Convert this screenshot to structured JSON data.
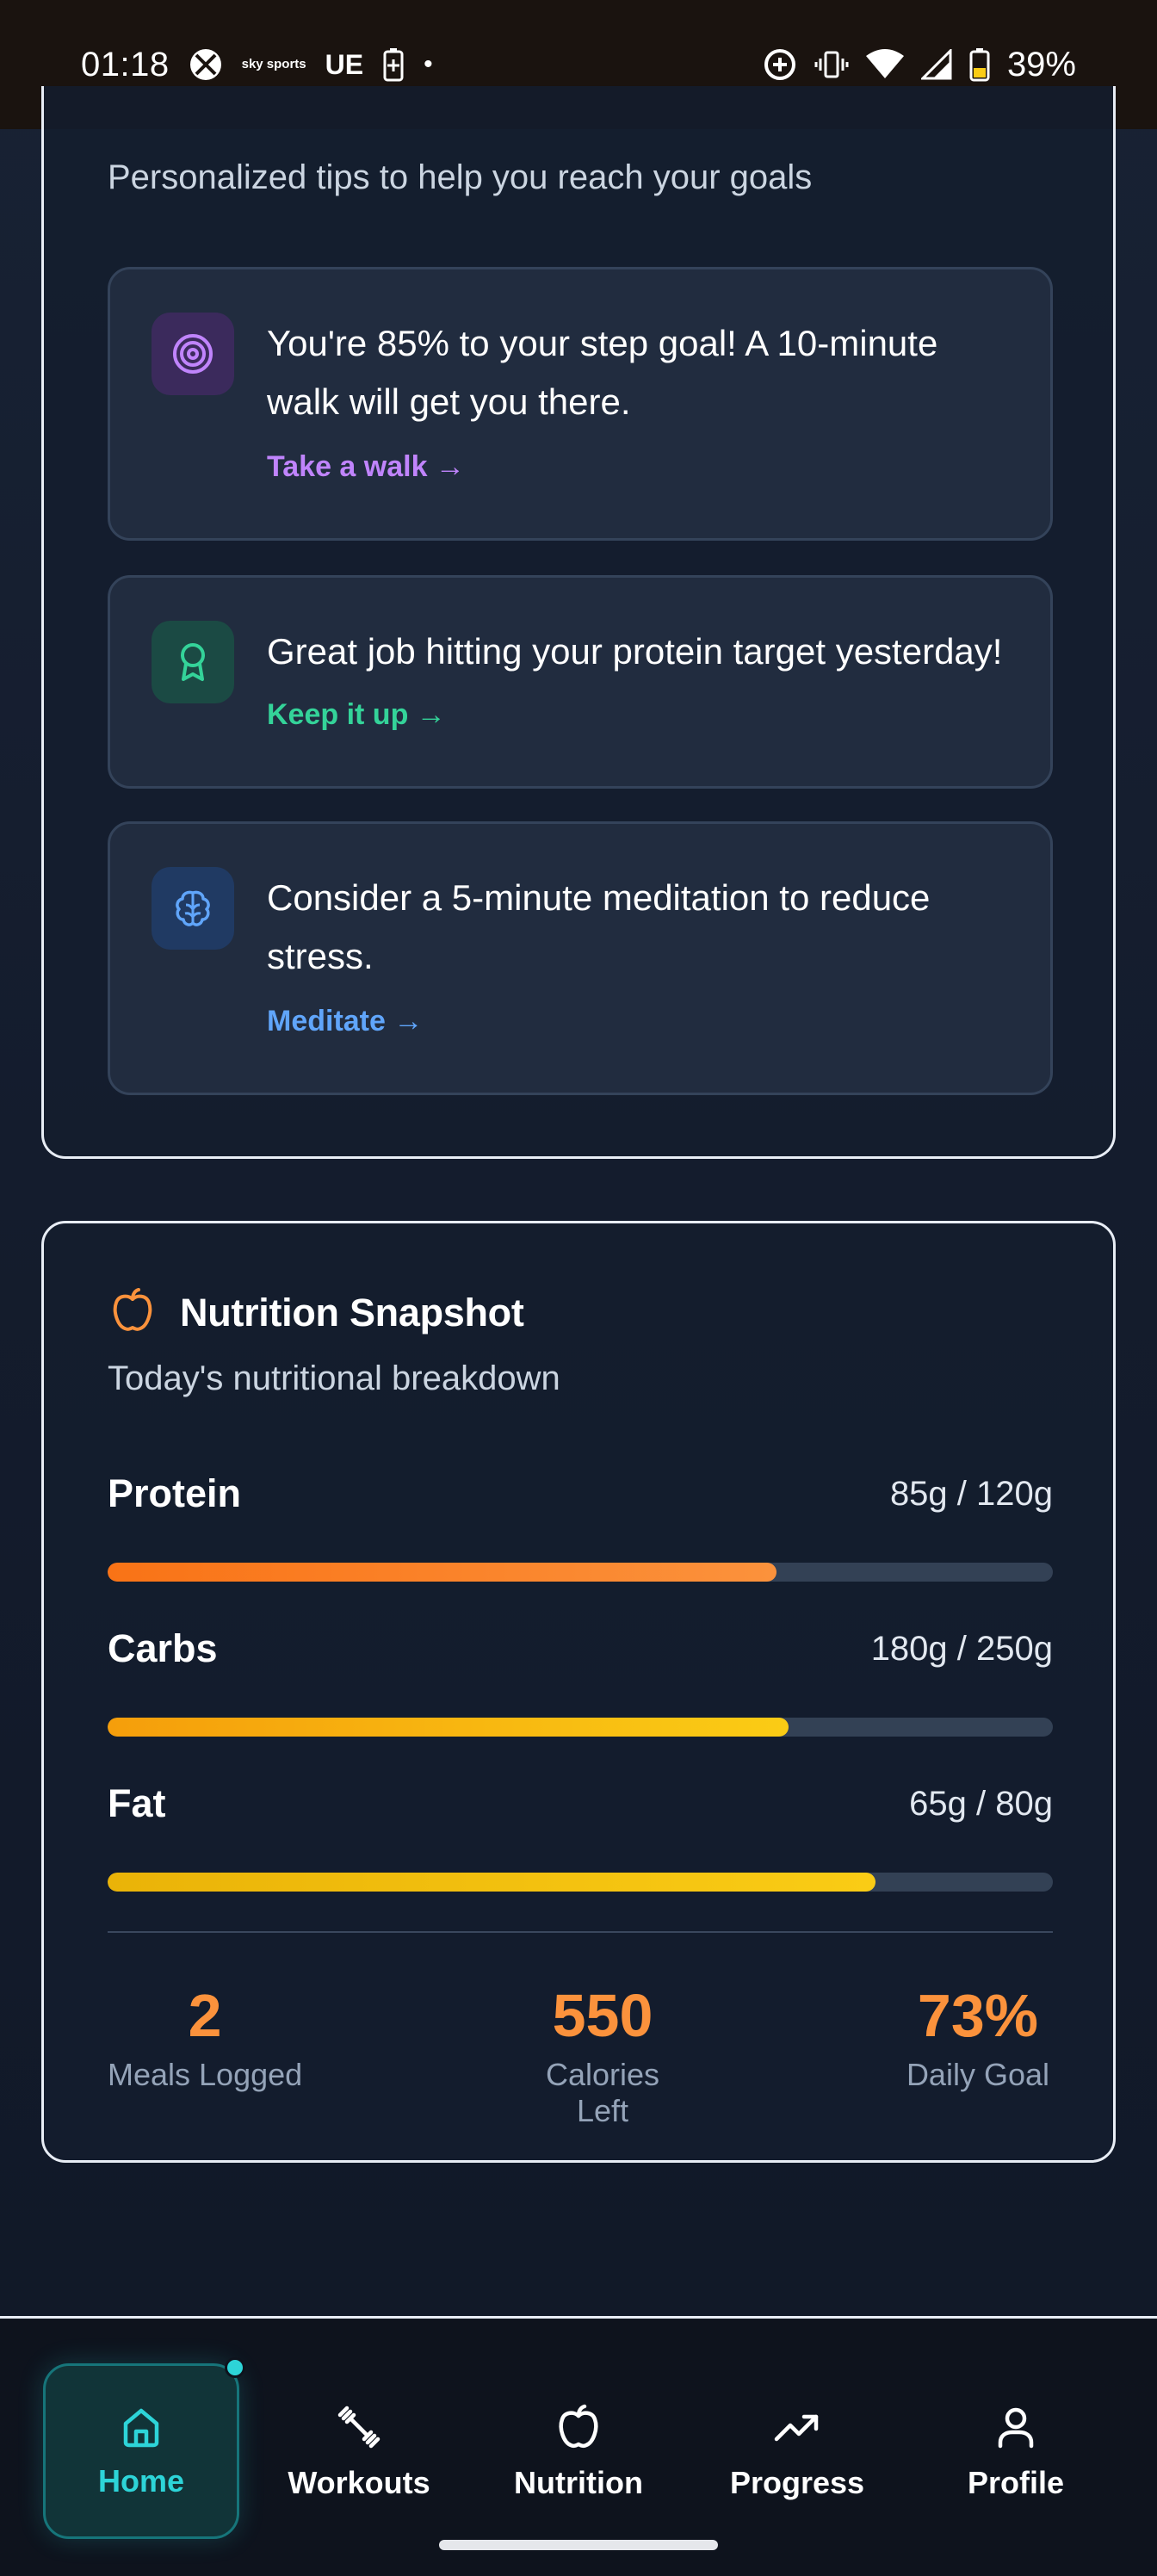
{
  "status_bar": {
    "time": "01:18",
    "sky_sports": "sky sports",
    "ue": "UE",
    "battery": "39%"
  },
  "insights": {
    "subtitle": "Personalized tips to help you reach your goals",
    "tips": [
      {
        "text": "You're 85% to your step goal! A 10-minute walk will get you there.",
        "action": "Take a walk →",
        "icon": "target-icon",
        "color": "#c084fc"
      },
      {
        "text": "Great job hitting your protein target yesterday!",
        "action": "Keep it up →",
        "icon": "award-icon",
        "color": "#34d399"
      },
      {
        "text": "Consider a 5-minute meditation to reduce stress.",
        "action": "Meditate →",
        "icon": "brain-icon",
        "color": "#60a5fa"
      }
    ]
  },
  "nutrition": {
    "title": "Nutrition Snapshot",
    "subtitle": "Today's nutritional breakdown",
    "macros": [
      {
        "name": "Protein",
        "amount": "85g / 120g",
        "progress": 0.708
      },
      {
        "name": "Carbs",
        "amount": "180g / 250g",
        "progress": 0.72
      },
      {
        "name": "Fat",
        "amount": "65g / 80g",
        "progress": 0.8125
      }
    ],
    "stats": [
      {
        "value": "2",
        "caption": "Meals Logged"
      },
      {
        "value": "550",
        "caption": "Calories Left"
      },
      {
        "value": "73%",
        "caption": "Daily Goal"
      }
    ]
  },
  "nav": {
    "items": [
      {
        "label": "Home",
        "icon": "home-icon",
        "active": true
      },
      {
        "label": "Workouts",
        "icon": "dumbbell-icon"
      },
      {
        "label": "Nutrition",
        "icon": "apple-icon"
      },
      {
        "label": "Progress",
        "icon": "trending-up-icon"
      },
      {
        "label": "Profile",
        "icon": "user-icon"
      }
    ]
  },
  "colors": {
    "accent_teal": "#2dd4d8",
    "nutrition_orange": "#fb923c",
    "protein_bar": "#f97316",
    "carbs_bar": "#facc15",
    "fat_bar": "#eab308"
  }
}
